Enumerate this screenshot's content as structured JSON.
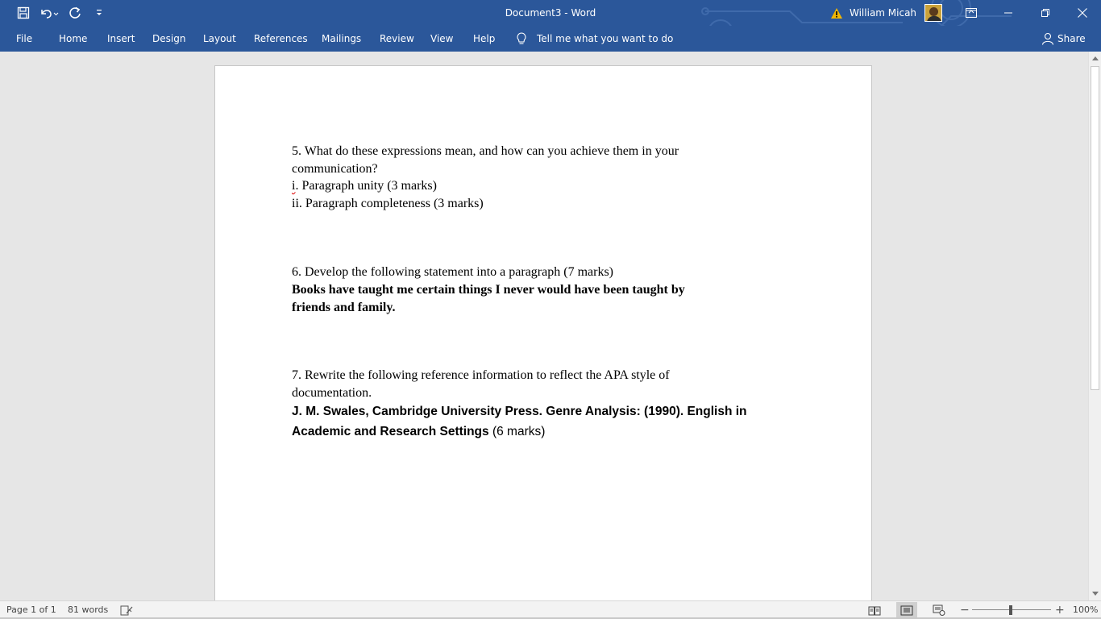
{
  "titlebar": {
    "document_title": "Document3  -  Word",
    "user_name": "William Micah",
    "qat": {
      "save_icon": "save-icon",
      "undo_icon": "undo-icon",
      "redo_icon": "redo-icon",
      "customize_icon": "chevron-down-icon"
    },
    "warning_icon": "warning-icon",
    "controls": [
      "ribbon-display-options",
      "minimize",
      "restore",
      "close"
    ]
  },
  "ribbon": {
    "tabs": [
      {
        "label": "File"
      },
      {
        "label": "Home"
      },
      {
        "label": "Insert"
      },
      {
        "label": "Design"
      },
      {
        "label": "Layout"
      },
      {
        "label": "References"
      },
      {
        "label": "Mailings"
      },
      {
        "label": "Review"
      },
      {
        "label": "View"
      },
      {
        "label": "Help"
      }
    ],
    "tell_me": "Tell me what you want to do",
    "share": "Share"
  },
  "document": {
    "q5": {
      "line1": "5. What do these expressions mean, and how can you achieve them in your",
      "line2": "communication?",
      "item1_marker": "i",
      "item1_rest": ". Paragraph unity (3 marks)",
      "item2": "ii. Paragraph completeness (3 marks)"
    },
    "q6": {
      "line1": "6. Develop the following statement into a paragraph (7 marks)",
      "statement_line1": "Books have taught me certain things I never would have been taught by",
      "statement_line2": "friends and family."
    },
    "q7": {
      "line1": "7. Rewrite the following reference information to reflect the APA style of",
      "line2": "documentation.",
      "reference_line1": "J. M. Swales, Cambridge University Press. Genre Analysis: (1990). English in",
      "reference_line2_bold": "Academic and Research Settings",
      "reference_line2_rest": " (6 marks)"
    }
  },
  "statusbar": {
    "page": "Page 1 of 1",
    "words": "81 words",
    "zoom": "100%",
    "zoom_minus": "−",
    "zoom_plus": "+",
    "zoom_level": 1.0
  },
  "colors": {
    "accent": "#2b579a",
    "background": "#e6e6e6",
    "page": "#ffffff"
  }
}
